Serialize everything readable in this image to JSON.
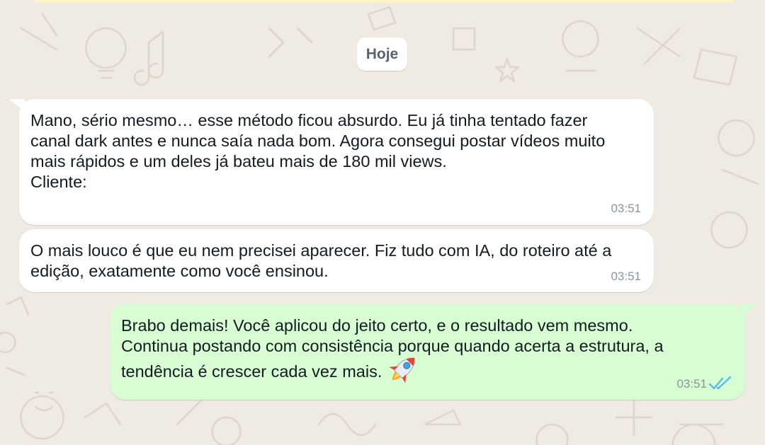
{
  "date_separator": "Hoje",
  "messages": [
    {
      "direction": "incoming",
      "text": "Mano, sério mesmo… esse método ficou absurdo. Eu já tinha tentado fazer\ncanal dark antes e nunca saía nada bom. Agora consegui postar vídeos muito\nmais rápidos e um deles já bateu mais de 180 mil views.\nCliente:",
      "time": "03:51"
    },
    {
      "direction": "incoming",
      "text": "O mais louco é que eu nem precisei aparecer. Fiz tudo com IA, do roteiro até a\nedição, exatamente como você ensinou.",
      "time": "03:51"
    },
    {
      "direction": "outgoing",
      "text": "Brabo demais! Você aplicou do jeito certo, e o resultado vem mesmo.\nContinua postando com consistência porque quando acerta a estrutura, a\ntendência é crescer cada vez mais.",
      "emoji": "rocket-emoji",
      "time": "03:51",
      "status": "read"
    }
  ],
  "colors": {
    "wallpaper": "#efeae2",
    "incoming_bubble": "#ffffff",
    "outgoing_bubble": "#d9fdd3",
    "read_ticks": "#53bdeb",
    "timestamp": "#8696a0"
  }
}
